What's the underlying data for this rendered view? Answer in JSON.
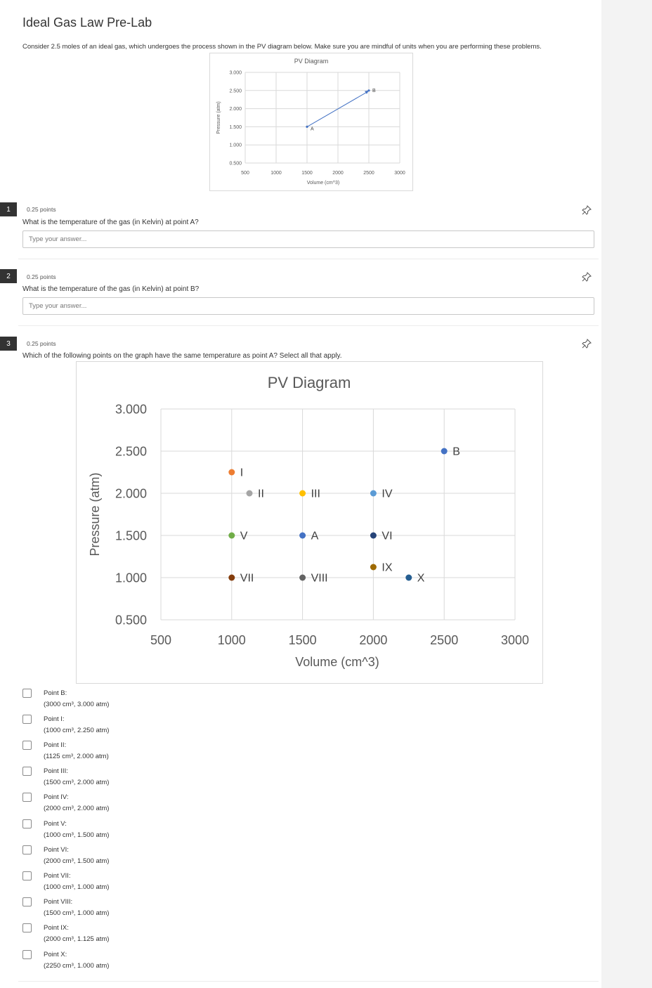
{
  "page": {
    "title": "Ideal Gas Law Pre-Lab",
    "intro": "Consider 2.5 moles of an ideal gas, which undergoes the process shown in the PV diagram below. Make sure you are mindful of units when you are performing these problems."
  },
  "answer_placeholder": "Type your answer...",
  "icons": {
    "pin": "pin-icon",
    "checkbox": "checkbox-icon"
  },
  "questions": [
    {
      "number": "1",
      "points": "0.25 points",
      "text": "What is the temperature of the gas (in Kelvin) at point A?"
    },
    {
      "number": "2",
      "points": "0.25 points",
      "text": "What is the temperature of the gas (in Kelvin) at point B?"
    },
    {
      "number": "3",
      "points": "0.25 points",
      "text": "Which of the following points on the graph have the same temperature as point A? Select all that apply."
    }
  ],
  "options": [
    {
      "label": "Point B:",
      "coords": "(3000 cm³, 3.000 atm)"
    },
    {
      "label": "Point I:",
      "coords": "(1000 cm³, 2.250 atm)"
    },
    {
      "label": "Point II:",
      "coords": "(1125 cm³, 2.000 atm)"
    },
    {
      "label": "Point III:",
      "coords": "(1500 cm³, 2.000 atm)"
    },
    {
      "label": "Point IV:",
      "coords": "(2000 cm³, 2.000 atm)"
    },
    {
      "label": "Point V:",
      "coords": "(1000 cm³, 1.500 atm)"
    },
    {
      "label": "Point VI:",
      "coords": "(2000 cm³, 1.500 atm)"
    },
    {
      "label": "Point VII:",
      "coords": "(1000 cm³, 1.000 atm)"
    },
    {
      "label": "Point VIII:",
      "coords": "(1500 cm³, 1.000 atm)"
    },
    {
      "label": "Point IX:",
      "coords": "(2000 cm³, 1.125 atm)"
    },
    {
      "label": "Point X:",
      "coords": "(2250 cm³, 1.000 atm)"
    }
  ],
  "chart_data": [
    {
      "type": "line",
      "title": "PV Diagram",
      "xlabel": "Volume (cm^3)",
      "ylabel": "Pressure (atm)",
      "xlim": [
        500,
        3000
      ],
      "ylim": [
        0.5,
        3.0
      ],
      "xticks": [
        "500",
        "1000",
        "1500",
        "2000",
        "2500",
        "3000"
      ],
      "yticks": [
        "0.500",
        "1.000",
        "1.500",
        "2.000",
        "2.500",
        "3.000"
      ],
      "grid": true,
      "series": [
        {
          "color": "#4472c4",
          "points": [
            {
              "x": 1500,
              "y": 1.5,
              "label": "A"
            },
            {
              "x": 2500,
              "y": 2.5,
              "label": "B"
            }
          ]
        }
      ]
    },
    {
      "type": "scatter",
      "title": "PV Diagram",
      "xlabel": "Volume (cm^3)",
      "ylabel": "Pressure (atm)",
      "xlim": [
        500,
        3000
      ],
      "ylim": [
        0.5,
        3.0
      ],
      "xticks": [
        "500",
        "1000",
        "1500",
        "2000",
        "2500",
        "3000"
      ],
      "yticks": [
        "0.500",
        "1.000",
        "1.500",
        "2.000",
        "2.500",
        "3.000"
      ],
      "grid": true,
      "points": [
        {
          "label": "I",
          "x": 1000,
          "y": 2.25,
          "color": "#ed7d31"
        },
        {
          "label": "II",
          "x": 1125,
          "y": 2.0,
          "color": "#a5a5a5"
        },
        {
          "label": "III",
          "x": 1500,
          "y": 2.0,
          "color": "#ffc000"
        },
        {
          "label": "IV",
          "x": 2000,
          "y": 2.0,
          "color": "#5b9bd5"
        },
        {
          "label": "V",
          "x": 1000,
          "y": 1.5,
          "color": "#70ad47"
        },
        {
          "label": "A",
          "x": 1500,
          "y": 1.5,
          "color": "#4472c4"
        },
        {
          "label": "VI",
          "x": 2000,
          "y": 1.5,
          "color": "#264478"
        },
        {
          "label": "IX",
          "x": 2000,
          "y": 1.125,
          "color": "#9e6a03"
        },
        {
          "label": "VII",
          "x": 1000,
          "y": 1.0,
          "color": "#843c0c"
        },
        {
          "label": "VIII",
          "x": 1500,
          "y": 1.0,
          "color": "#636363"
        },
        {
          "label": "X",
          "x": 2250,
          "y": 1.0,
          "color": "#255e91"
        },
        {
          "label": "B",
          "x": 2500,
          "y": 2.5,
          "color": "#4472c4"
        }
      ]
    }
  ]
}
